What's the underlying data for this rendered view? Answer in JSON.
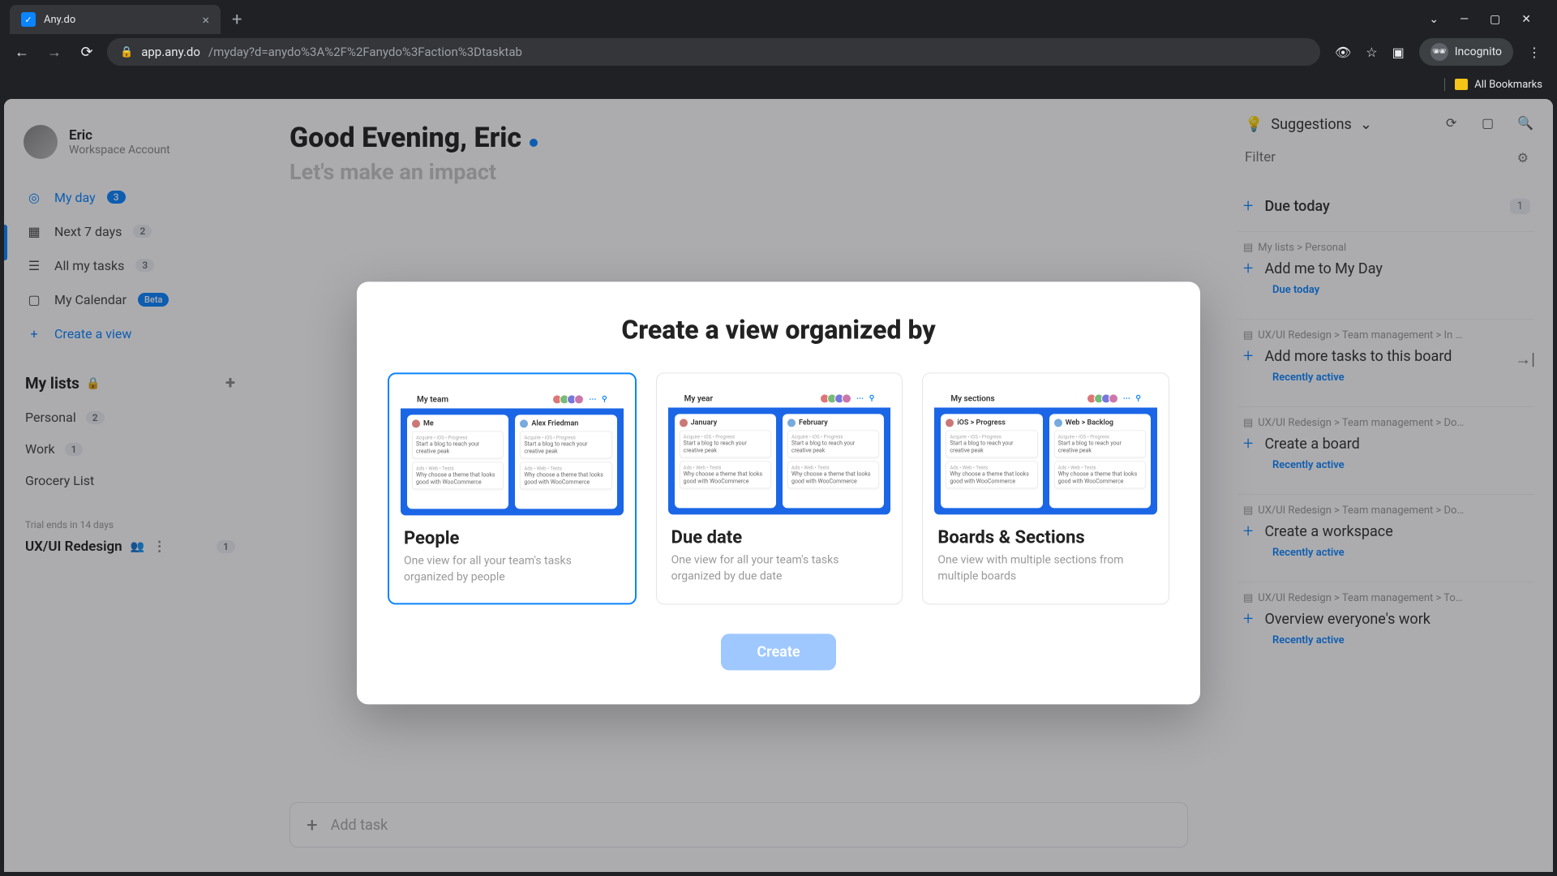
{
  "browser": {
    "tab_title": "Any.do",
    "url_host": "app.any.do",
    "url_path": "/myday?d=anydo%3A%2F%2Fanydo%3Faction%3Dtasktab",
    "incognito": "Incognito",
    "all_bookmarks": "All Bookmarks"
  },
  "user": {
    "name": "Eric",
    "account": "Workspace Account"
  },
  "nav": {
    "my_day": "My day",
    "my_day_count": "3",
    "next7": "Next 7 days",
    "next7_count": "2",
    "all_tasks": "All my tasks",
    "all_tasks_count": "3",
    "calendar": "My Calendar",
    "calendar_badge": "Beta",
    "create_view": "Create a view"
  },
  "lists": {
    "header": "My lists",
    "personal": "Personal",
    "personal_count": "2",
    "work": "Work",
    "work_count": "1",
    "grocery": "Grocery List"
  },
  "workspace": {
    "trial": "Trial ends in 14 days",
    "project": "UX/UI Redesign",
    "project_count": "1"
  },
  "main": {
    "greeting": "Good Evening, Eric",
    "subtitle": "Let's make an impact",
    "add_task_placeholder": "Add task"
  },
  "rpanel": {
    "suggestions": "Suggestions",
    "filter_placeholder": "Filter",
    "due_today": "Due today",
    "due_today_count": "1",
    "items": [
      {
        "crumb": "My lists > Personal",
        "label": "Add me to My Day",
        "meta": "Due today"
      },
      {
        "crumb": "UX/UI Redesign > Team management > In …",
        "label": "Add more tasks to this board",
        "meta": "Recently active"
      },
      {
        "crumb": "UX/UI Redesign > Team management > Do…",
        "label": "Create a board",
        "meta": "Recently active"
      },
      {
        "crumb": "UX/UI Redesign > Team management > Do…",
        "label": "Create a workspace",
        "meta": "Recently active"
      },
      {
        "crumb": "UX/UI Redesign > Team management > To…",
        "label": "Overview everyone's work",
        "meta": "Recently active"
      }
    ]
  },
  "modal": {
    "title": "Create a view organized by",
    "cards": [
      {
        "title": "People",
        "desc": "One view for all your team's tasks organized by people",
        "tab": "My team",
        "c1": "Me",
        "c2": "Alex Friedman",
        "selected": true
      },
      {
        "title": "Due date",
        "desc": "One view for all your team's tasks organized by due date",
        "tab": "My year",
        "c1": "January",
        "c2": "February",
        "selected": false
      },
      {
        "title": "Boards & Sections",
        "desc": "One view with multiple sections from multiple boards",
        "tab": "My sections",
        "c1": "iOS > Progress",
        "c2": "Web > Backlog",
        "selected": false
      }
    ],
    "create": "Create"
  }
}
